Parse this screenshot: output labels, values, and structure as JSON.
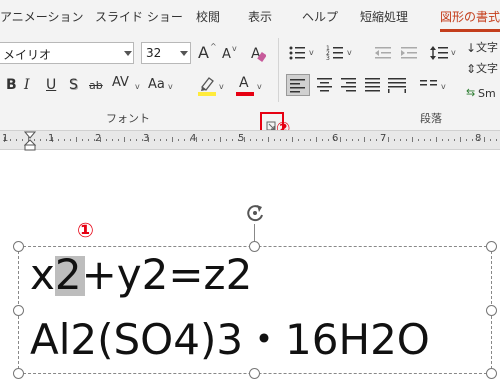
{
  "ribbon": {
    "tabs": [
      {
        "label": "アニメーション"
      },
      {
        "label": "スライド ショー"
      },
      {
        "label": "校閲"
      },
      {
        "label": "表示"
      },
      {
        "label": "ヘルプ"
      },
      {
        "label": "短縮処理"
      },
      {
        "label": "図形の書式"
      }
    ],
    "font_name_value": "メイリオ",
    "font_size_value": "32",
    "increase_font_glyph": "A",
    "decrease_font_glyph": "A",
    "bold_glyph": "B",
    "italic_glyph": "I",
    "underline_glyph": "U",
    "shadow_glyph": "S",
    "strike_glyph": "ab",
    "spacing_glyph": "AV",
    "case_glyph": "Aa",
    "font_color_glyph": "A",
    "text_direction_label": "文字",
    "align_text_label": "文字",
    "smartart_label": "Sm",
    "font_group_label": "フォント",
    "paragraph_group_label": "段落",
    "highlight_color": "#ffeb3b",
    "font_color": "#e60012"
  },
  "ruler": {
    "numbers": [
      "1",
      "1",
      "2",
      "3",
      "4",
      "5",
      "6",
      "7",
      "8"
    ]
  },
  "document": {
    "line1": "x2+y2=z2",
    "line2": "Al2(SO4)3・16H2O"
  },
  "annotations": {
    "marker1": "①",
    "marker2": "②",
    "accent": "#e60012"
  }
}
